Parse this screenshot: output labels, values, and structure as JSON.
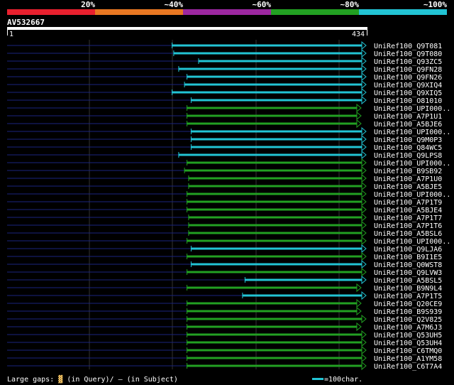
{
  "colors": {
    "background": "#000000",
    "band_red": "#e8202e",
    "band_orange": "#e87722",
    "band_purple": "#9c27a0",
    "band_green": "#22a022",
    "band_cyan": "#22c4d4",
    "query_line": "#1a237e",
    "hit_cyan": "#22c4d4",
    "hit_green": "#22a022",
    "grid": "#333333"
  },
  "header": {
    "pct_labels": [
      "20%",
      "~40%",
      "~60%",
      "~80%",
      "~100%"
    ],
    "query_id": "AV532667",
    "scale_start": "1",
    "scale_end": "434"
  },
  "query_length": 434,
  "hits": [
    {
      "label": "UniRef100_Q9T081",
      "start": 200,
      "end": 434,
      "color": "cyan"
    },
    {
      "label": "UniRef100_Q9T080",
      "start": 202,
      "end": 434,
      "color": "cyan"
    },
    {
      "label": "UniRef100_Q93ZC5",
      "start": 232,
      "end": 434,
      "color": "cyan"
    },
    {
      "label": "UniRef100_Q9FN28",
      "start": 208,
      "end": 434,
      "color": "cyan"
    },
    {
      "label": "UniRef100_Q9FN26",
      "start": 218,
      "end": 434,
      "color": "cyan"
    },
    {
      "label": "UniRef100_Q9XIQ4",
      "start": 215,
      "end": 434,
      "color": "cyan"
    },
    {
      "label": "UniRef100_Q9XIQ5",
      "start": 200,
      "end": 434,
      "color": "cyan"
    },
    {
      "label": "UniRef100_O81010",
      "start": 223,
      "end": 434,
      "color": "cyan"
    },
    {
      "label": "UniRef100_UPI000..",
      "start": 218,
      "end": 428,
      "color": "green"
    },
    {
      "label": "UniRef100_A7P1U1",
      "start": 218,
      "end": 428,
      "color": "green"
    },
    {
      "label": "UniRef100_A5BJE6",
      "start": 218,
      "end": 428,
      "color": "green"
    },
    {
      "label": "UniRef100_UPI000..",
      "start": 223,
      "end": 434,
      "color": "cyan"
    },
    {
      "label": "UniRef100_Q9M0P3",
      "start": 223,
      "end": 434,
      "color": "cyan"
    },
    {
      "label": "UniRef100_Q84WC5",
      "start": 223,
      "end": 434,
      "color": "cyan"
    },
    {
      "label": "UniRef100_Q9LPS8",
      "start": 208,
      "end": 434,
      "color": "cyan"
    },
    {
      "label": "UniRef100_UPI000..",
      "start": 218,
      "end": 434,
      "color": "green"
    },
    {
      "label": "UniRef100_B9SB92",
      "start": 215,
      "end": 434,
      "color": "green"
    },
    {
      "label": "UniRef100_A7P1U0",
      "start": 220,
      "end": 434,
      "color": "green"
    },
    {
      "label": "UniRef100_A5BJE5",
      "start": 220,
      "end": 434,
      "color": "green"
    },
    {
      "label": "UniRef100_UPI000..",
      "start": 218,
      "end": 434,
      "color": "green"
    },
    {
      "label": "UniRef100_A7P1T9",
      "start": 218,
      "end": 434,
      "color": "green"
    },
    {
      "label": "UniRef100_A5BJE4",
      "start": 218,
      "end": 434,
      "color": "green"
    },
    {
      "label": "UniRef100_A7P1T7",
      "start": 220,
      "end": 434,
      "color": "green"
    },
    {
      "label": "UniRef100_A7P1T6",
      "start": 220,
      "end": 434,
      "color": "green"
    },
    {
      "label": "UniRef100_A5BSL6",
      "start": 220,
      "end": 434,
      "color": "green"
    },
    {
      "label": "UniRef100_UPI000..",
      "start": 218,
      "end": 434,
      "color": "green"
    },
    {
      "label": "UniRef100_Q9LJA6",
      "start": 223,
      "end": 434,
      "color": "cyan"
    },
    {
      "label": "UniRef100_B9I1E5",
      "start": 218,
      "end": 434,
      "color": "green"
    },
    {
      "label": "UniRef100_Q0WST8",
      "start": 223,
      "end": 434,
      "color": "cyan"
    },
    {
      "label": "UniRef100_Q9LVW3",
      "start": 218,
      "end": 434,
      "color": "green"
    },
    {
      "label": "UniRef100_A5BSL5",
      "start": 288,
      "end": 434,
      "color": "cyan"
    },
    {
      "label": "UniRef100_B9N9L4",
      "start": 218,
      "end": 428,
      "color": "green"
    },
    {
      "label": "UniRef100_A7P1T5",
      "start": 285,
      "end": 434,
      "color": "cyan"
    },
    {
      "label": "UniRef100_Q20CE9",
      "start": 218,
      "end": 428,
      "color": "green"
    },
    {
      "label": "UniRef100_B9S939",
      "start": 218,
      "end": 428,
      "color": "green"
    },
    {
      "label": "UniRef100_Q2V825",
      "start": 218,
      "end": 434,
      "color": "green"
    },
    {
      "label": "UniRef100_A7M6J3",
      "start": 218,
      "end": 428,
      "color": "green"
    },
    {
      "label": "UniRef100_Q53UH5",
      "start": 218,
      "end": 434,
      "color": "green"
    },
    {
      "label": "UniRef100_Q53UH4",
      "start": 218,
      "end": 434,
      "color": "green"
    },
    {
      "label": "UniRef100_C6TMQ0",
      "start": 218,
      "end": 434,
      "color": "green"
    },
    {
      "label": "UniRef100_A1YM58",
      "start": 218,
      "end": 434,
      "color": "green"
    },
    {
      "label": "UniRef100_C6T7A4",
      "start": 218,
      "end": 434,
      "color": "green"
    }
  ],
  "footer": {
    "large_gaps_prefix": "Large gaps:",
    "query_gap_glyph": "▓",
    "query_gap_text": "(in Query)/",
    "subject_gap_glyph": "–",
    "subject_gap_text": " (in Subject)",
    "scale_legend": "=100char."
  }
}
